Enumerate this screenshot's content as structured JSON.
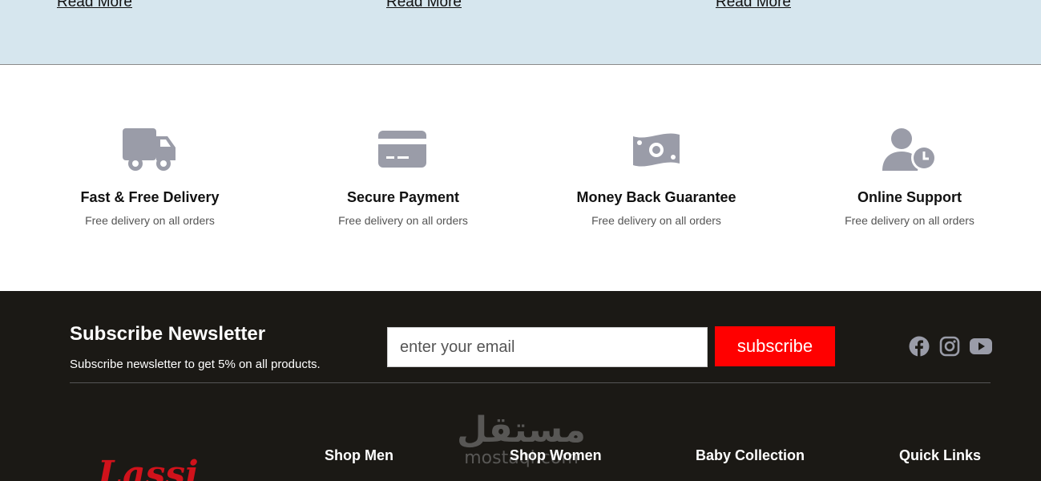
{
  "blog": {
    "read_more_labels": [
      "Read More",
      "Read More",
      "Read More"
    ]
  },
  "features": [
    {
      "icon": "truck-icon",
      "title": "Fast & Free Delivery",
      "desc": "Free delivery on all orders"
    },
    {
      "icon": "credit-card-icon",
      "title": "Secure Payment",
      "desc": "Free delivery on all orders"
    },
    {
      "icon": "money-bill-icon",
      "title": "Money Back Guarantee",
      "desc": "Free delivery on all orders"
    },
    {
      "icon": "user-clock-icon",
      "title": "Online Support",
      "desc": "Free delivery on all orders"
    }
  ],
  "newsletter": {
    "title": "Subscribe Newsletter",
    "subtitle": "Subscribe newsletter to get 5% on all products.",
    "email_placeholder": "enter your email",
    "button_label": "subscribe"
  },
  "socials": [
    "facebook-icon",
    "instagram-icon",
    "youtube-icon"
  ],
  "footer_columns": [
    "Shop Men",
    "Shop Women",
    "Baby Collection",
    "Quick Links"
  ],
  "logo": {
    "text": "Lassi"
  },
  "watermark": {
    "arabic": "مستقل",
    "latin": "mostaql.com"
  },
  "colors": {
    "accent": "#ff0000",
    "footer_bg": "#1b1915",
    "icon": "#9a9ca8",
    "strip_bg": "#d6e6ee"
  }
}
